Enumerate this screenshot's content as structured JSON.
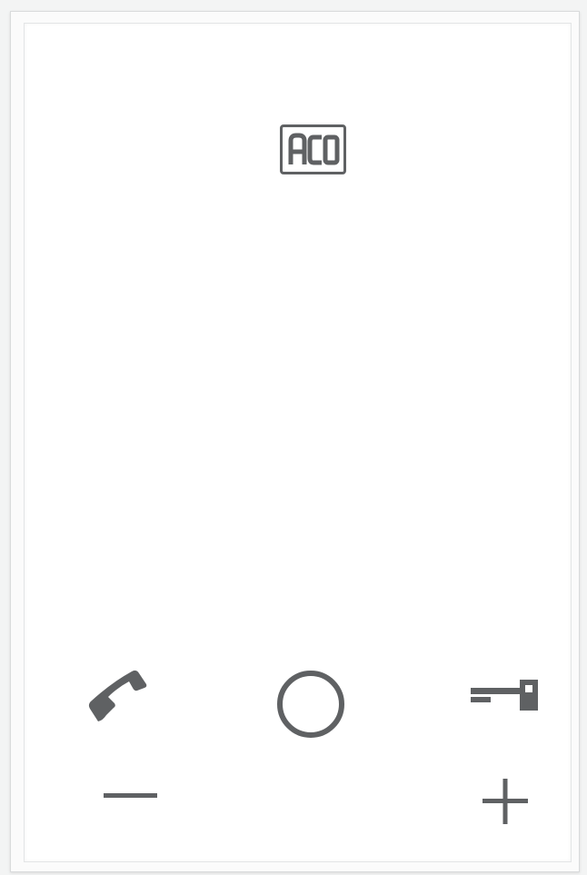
{
  "brand": {
    "logo_text": "ACO"
  },
  "colors": {
    "icon": "#5f6163",
    "panel": "#ffffff",
    "frame": "#fbfbfb"
  },
  "controls": [
    {
      "name": "handset-button",
      "icon": "phone-handset-icon"
    },
    {
      "name": "center-button",
      "icon": "circle-icon"
    },
    {
      "name": "door-unlock-button",
      "icon": "key-icon"
    },
    {
      "name": "volume-down-button",
      "icon": "minus-icon"
    },
    {
      "name": "volume-up-button",
      "icon": "plus-icon"
    }
  ]
}
